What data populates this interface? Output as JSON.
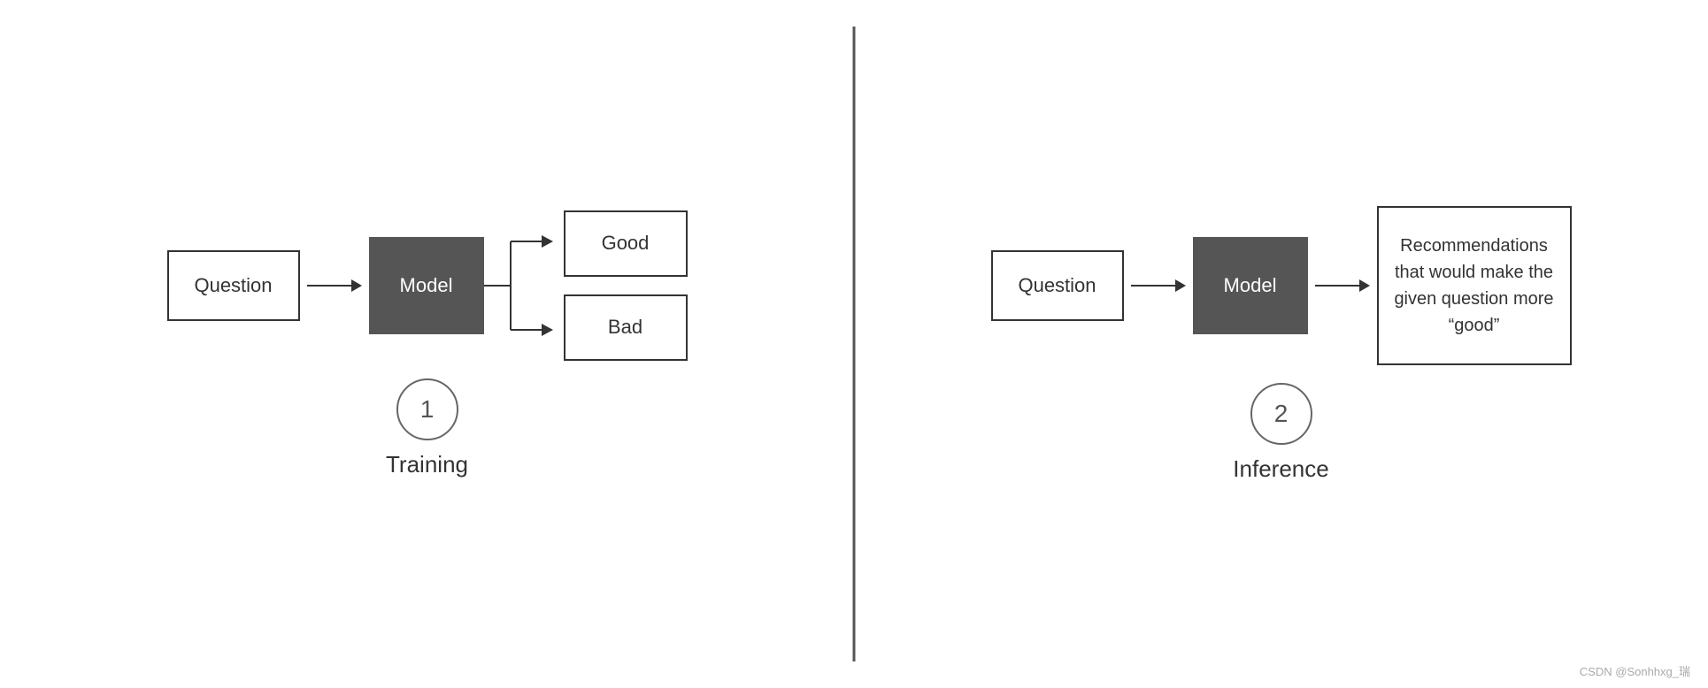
{
  "training": {
    "label": "Training",
    "number": "1",
    "question_box": "Question",
    "model_box": "Model",
    "good_box": "Good",
    "bad_box": "Bad"
  },
  "inference": {
    "label": "Inference",
    "number": "2",
    "question_box": "Question",
    "model_box": "Model",
    "recommendation_box": "Recommendations that would make the given question more “good”"
  },
  "watermark": "CSDN @Sonhhxg_瑞"
}
